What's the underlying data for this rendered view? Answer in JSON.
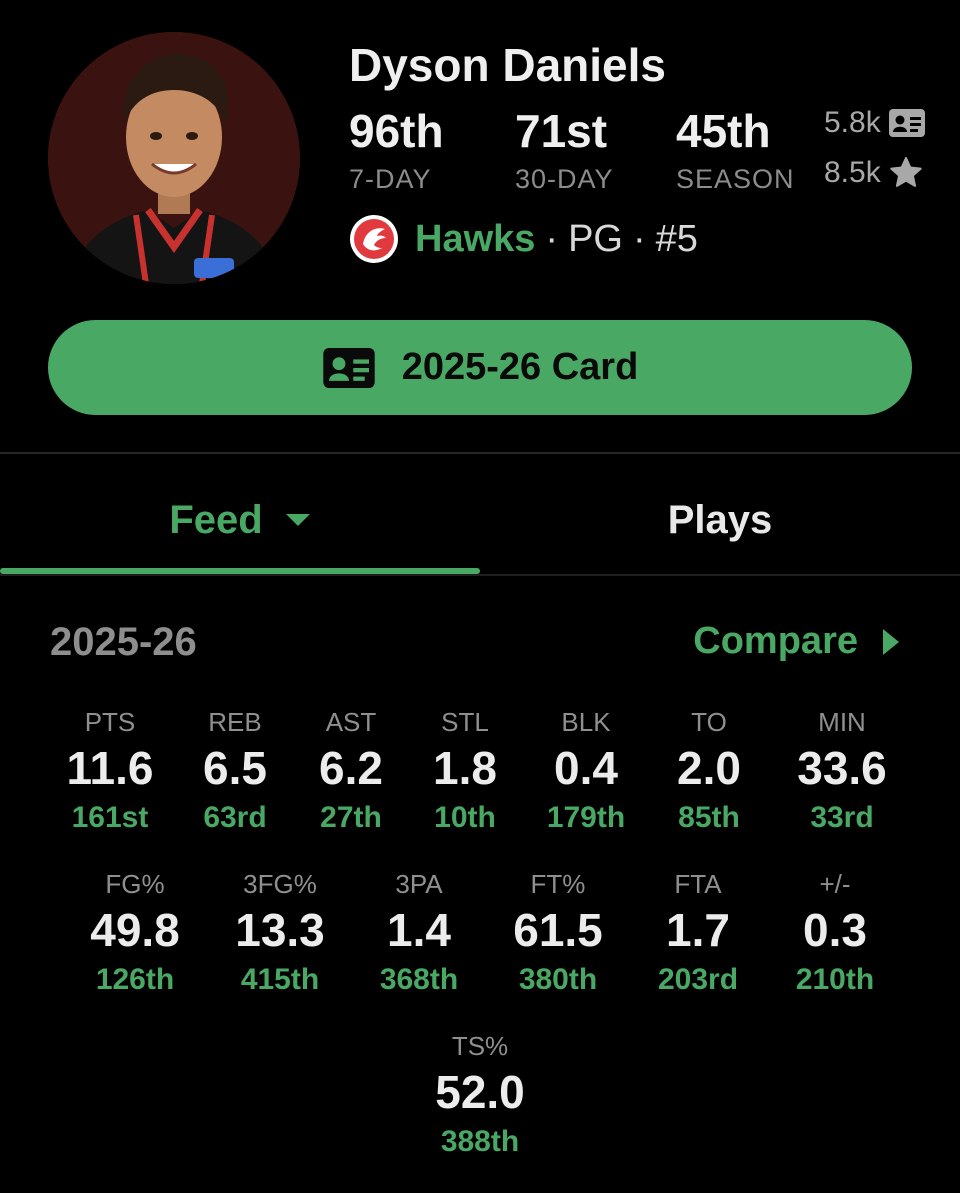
{
  "player": {
    "name": "Dyson Daniels",
    "team": "Hawks",
    "position": "PG",
    "number": "#5"
  },
  "rankings": [
    {
      "value": "96th",
      "label": "7-DAY"
    },
    {
      "value": "71st",
      "label": "30-DAY"
    },
    {
      "value": "45th",
      "label": "SEASON"
    }
  ],
  "counts": {
    "cards": "5.8k",
    "favorites": "8.5k"
  },
  "card_button": {
    "label": "2025-26 Card"
  },
  "tabs": {
    "feed": "Feed",
    "plays": "Plays"
  },
  "season": {
    "label": "2025-26",
    "compare": "Compare"
  },
  "stats_row1": [
    {
      "label": "PTS",
      "value": "11.6",
      "rank": "161st"
    },
    {
      "label": "REB",
      "value": "6.5",
      "rank": "63rd"
    },
    {
      "label": "AST",
      "value": "6.2",
      "rank": "27th"
    },
    {
      "label": "STL",
      "value": "1.8",
      "rank": "10th"
    },
    {
      "label": "BLK",
      "value": "0.4",
      "rank": "179th"
    },
    {
      "label": "TO",
      "value": "2.0",
      "rank": "85th"
    },
    {
      "label": "MIN",
      "value": "33.6",
      "rank": "33rd"
    }
  ],
  "stats_row2": [
    {
      "label": "FG%",
      "value": "49.8",
      "rank": "126th"
    },
    {
      "label": "3FG%",
      "value": "13.3",
      "rank": "415th"
    },
    {
      "label": "3PA",
      "value": "1.4",
      "rank": "368th"
    },
    {
      "label": "FT%",
      "value": "61.5",
      "rank": "380th"
    },
    {
      "label": "FTA",
      "value": "1.7",
      "rank": "203rd"
    },
    {
      "label": "+/-",
      "value": "0.3",
      "rank": "210th"
    }
  ],
  "stats_row3": [
    {
      "label": "TS%",
      "value": "52.0",
      "rank": "388th"
    }
  ],
  "colors": {
    "accent": "#4aa865",
    "background": "#000000",
    "team_red": "#e03a3e"
  }
}
